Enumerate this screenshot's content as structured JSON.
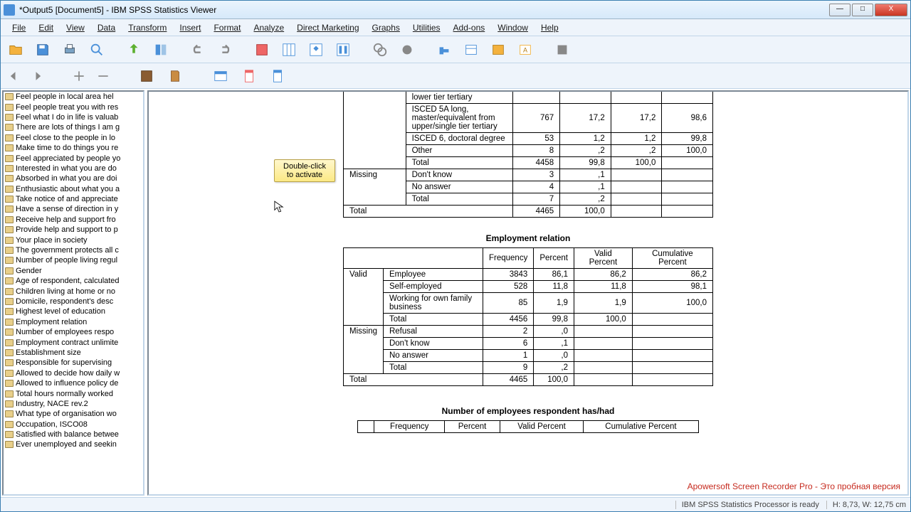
{
  "window": {
    "title": "*Output5 [Document5] - IBM SPSS Statistics Viewer"
  },
  "menu": [
    "File",
    "Edit",
    "View",
    "Data",
    "Transform",
    "Insert",
    "Format",
    "Analyze",
    "Direct Marketing",
    "Graphs",
    "Utilities",
    "Add-ons",
    "Window",
    "Help"
  ],
  "outline": [
    "Feel people in local area hel",
    "Feel people treat you with res",
    "Feel what I do in life is valuab",
    "There are lots of things I am g",
    "Feel close to the people in lo",
    "Make time to do things you re",
    "Feel appreciated by people yo",
    "Interested in what you are do",
    "Absorbed in what you are doi",
    "Enthusiastic about what you a",
    "Take notice of and appreciate",
    "Have a sense of direction in y",
    "Receive help and support fro",
    "Provide help and support to p",
    "Your place in society",
    "The government protects all c",
    "Number of people living regul",
    "Gender",
    "Age of respondent, calculated",
    "Children living at home or no",
    "Domicile, respondent's desc",
    "Highest level of education",
    "Employment relation",
    "Number of employees respo",
    "Employment contract unlimite",
    "Establishment size",
    "Responsible for supervising",
    "Allowed to decide how daily w",
    "Allowed to influence policy de",
    "Total hours normally worked",
    "Industry, NACE rev.2",
    "What type of organisation wo",
    "Occupation, ISCO08",
    "Satisfied with balance betwee",
    "Ever unemployed and seekin"
  ],
  "tooltip": "Double-click to activate",
  "top_table": {
    "rows": [
      {
        "label": "lower tier tertiary",
        "f": "",
        "p": "",
        "vp": "",
        "cp": ""
      },
      {
        "label": "ISCED 5A long, master/equivalent from upper/single tier tertiary",
        "f": "767",
        "p": "17,2",
        "vp": "17,2",
        "cp": "98,6"
      },
      {
        "label": "ISCED 6, doctoral degree",
        "f": "53",
        "p": "1,2",
        "vp": "1,2",
        "cp": "99,8"
      },
      {
        "label": "Other",
        "f": "8",
        "p": ",2",
        "vp": ",2",
        "cp": "100,0"
      },
      {
        "label": "Total",
        "f": "4458",
        "p": "99,8",
        "vp": "100,0",
        "cp": ""
      }
    ],
    "missing_label": "Missing",
    "missing": [
      {
        "label": "Don't know",
        "f": "3",
        "p": ",1"
      },
      {
        "label": "No answer",
        "f": "4",
        "p": ",1"
      },
      {
        "label": "Total",
        "f": "7",
        "p": ",2"
      }
    ],
    "total_label": "Total",
    "total": {
      "f": "4465",
      "p": "100,0"
    }
  },
  "table2": {
    "caption": "Employment relation",
    "headers": [
      "Frequency",
      "Percent",
      "Valid Percent",
      "Cumulative Percent"
    ],
    "valid_label": "Valid",
    "valid": [
      {
        "label": "Employee",
        "f": "3843",
        "p": "86,1",
        "vp": "86,2",
        "cp": "86,2"
      },
      {
        "label": "Self-employed",
        "f": "528",
        "p": "11,8",
        "vp": "11,8",
        "cp": "98,1"
      },
      {
        "label": "Working for own family business",
        "f": "85",
        "p": "1,9",
        "vp": "1,9",
        "cp": "100,0"
      },
      {
        "label": "Total",
        "f": "4456",
        "p": "99,8",
        "vp": "100,0",
        "cp": ""
      }
    ],
    "missing_label": "Missing",
    "missing": [
      {
        "label": "Refusal",
        "f": "2",
        "p": ",0"
      },
      {
        "label": "Don't know",
        "f": "6",
        "p": ",1"
      },
      {
        "label": "No answer",
        "f": "1",
        "p": ",0"
      },
      {
        "label": "Total",
        "f": "9",
        "p": ",2"
      }
    ],
    "total_label": "Total",
    "total": {
      "f": "4465",
      "p": "100,0"
    }
  },
  "table3": {
    "caption": "Number of employees respondent has/had",
    "headers": [
      "Frequency",
      "Percent",
      "Valid Percent",
      "Cumulative Percent"
    ]
  },
  "watermark": "Apowersoft Screen Recorder Pro - Это пробная версия",
  "status": {
    "proc": "IBM SPSS Statistics Processor is ready",
    "pos": "H: 8,73, W: 12,75 cm"
  }
}
